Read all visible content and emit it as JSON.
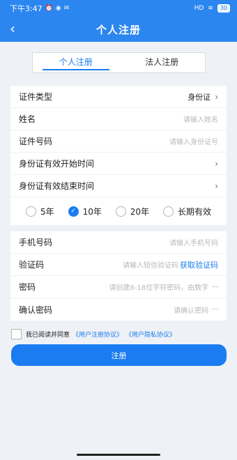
{
  "status_bar": {
    "time": "下午3:47",
    "network": "HD",
    "battery": "30"
  },
  "nav": {
    "title": "个人注册",
    "back_icon": "chevron-left-icon"
  },
  "tabs": [
    {
      "label": "个人注册",
      "active": true
    },
    {
      "label": "法人注册",
      "active": false
    }
  ],
  "form": {
    "id_type": {
      "label": "证件类型",
      "value": "身份证"
    },
    "name": {
      "label": "姓名",
      "placeholder": "请输入姓名"
    },
    "id_number": {
      "label": "证件号码",
      "placeholder": "请输入身份证号"
    },
    "valid_start": {
      "label": "身份证有效开始时间"
    },
    "valid_end": {
      "label": "身份证有效结束时间"
    },
    "validity_options": [
      {
        "label": "5年",
        "checked": false
      },
      {
        "label": "10年",
        "checked": true
      },
      {
        "label": "20年",
        "checked": false
      },
      {
        "label": "长期有效",
        "checked": false
      }
    ],
    "phone": {
      "label": "手机号码",
      "placeholder": "请输入手机号码"
    },
    "code": {
      "label": "验证码",
      "placeholder": "请输入短信验证码",
      "action": "获取验证码"
    },
    "password": {
      "label": "密码",
      "placeholder": "请创建8-18位字符密码，由数字"
    },
    "confirm_password": {
      "label": "确认密码",
      "placeholder": "请确认密码"
    }
  },
  "agreement": {
    "text": "我已阅读并同意",
    "link1": "《用户注册协议》",
    "link2": "《用户隐私协议》"
  },
  "submit_label": "注册",
  "colors": {
    "primary": "#2b86f0",
    "accent": "#1a7cf0",
    "background": "#eef1f6"
  }
}
